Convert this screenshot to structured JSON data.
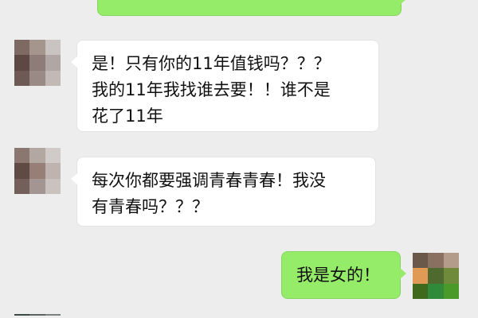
{
  "chat": {
    "messages": [
      {
        "side": "left",
        "text": "是！只有你的11年值钱吗？？？\n我的11年我找谁去要！！谁不是\n花了11年"
      },
      {
        "side": "left",
        "text": "每次你都要强调青春青春！我没\n有青春吗？？？"
      },
      {
        "side": "right",
        "text": "我是女的！"
      }
    ]
  },
  "colors": {
    "background": "#ededed",
    "bubble_self": "#95ec69",
    "bubble_other": "#ffffff"
  }
}
